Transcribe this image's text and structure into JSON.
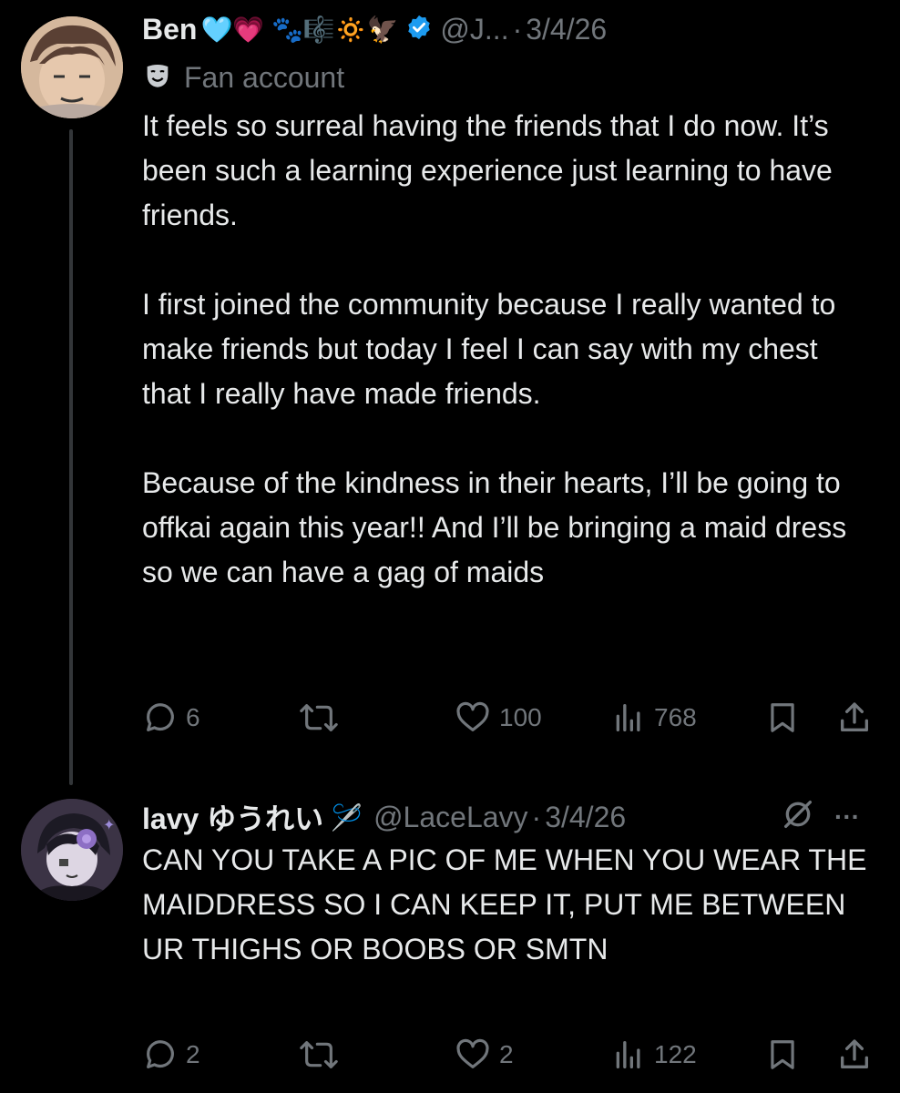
{
  "post1": {
    "name": "Ben",
    "name_emojis": "🩵💗 🐾🎼🔅🦅",
    "handle": "@J...",
    "sep": "·",
    "date": "3/4/26",
    "label_icon": "theater-mask-icon",
    "label": "Fan account",
    "text": "It feels so surreal having the friends that I do now. It’s been such a learning experience just learning to have friends.\n\nI first joined the community because I really wanted to make friends but today I feel I can say with my chest that I really have made friends.\n\nBecause of the kindness in their hearts, I’ll be going to offkai again this year!! And I’ll be bringing a maid dress so we can have a gag of maids",
    "replies": "6",
    "likes": "100",
    "views": "768"
  },
  "post2": {
    "name": "lavy ゆうれい",
    "name_emoji": "🪡",
    "handle": "@LaceLavy",
    "sep": "·",
    "date": "3/4/26",
    "more": "···",
    "text": "CAN YOU TAKE A PIC OF ME WHEN YOU WEAR THE MAIDDRESS SO I CAN KEEP IT, PUT ME BETWEEN UR THIGHS OR BOOBS OR SMTN",
    "replies": "2",
    "likes": "2",
    "views": "122"
  },
  "colors": {
    "background": "#000000",
    "text": "#e7e9ea",
    "muted": "#71767b",
    "verified": "#1d9bf0",
    "thread_line": "#333639"
  }
}
